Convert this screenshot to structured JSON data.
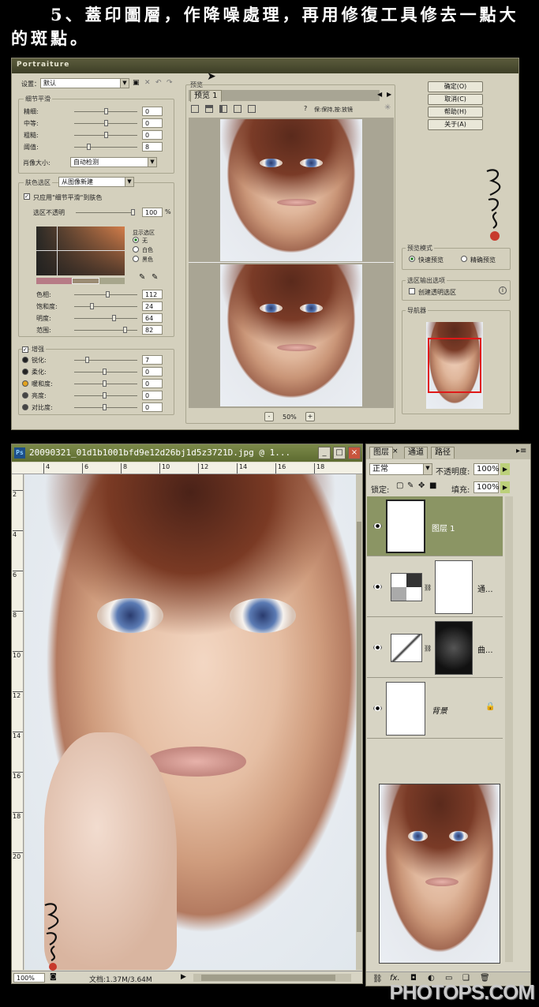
{
  "heading": {
    "line1": "5、蓋印圖層，作降噪處理，再用修復工具修去一點大",
    "line2": "的斑點。"
  },
  "portraiture": {
    "title": "Portraiture",
    "preset_label": "设置：",
    "preset_value": "默认",
    "detail_group": "细节平滑",
    "detail_rows": [
      {
        "label": "精细:",
        "value": "0"
      },
      {
        "label": "中等:",
        "value": "0"
      },
      {
        "label": "粗糙:",
        "value": "0"
      },
      {
        "label": "阈值:",
        "value": "8"
      }
    ],
    "portrait_size_label": "肖像大小:",
    "portrait_size_value": "自动检测",
    "skin_group": "肤色选区",
    "skin_mode": "从图像新建",
    "only_apply": "只应用\"细节平滑\"到肤色",
    "opacity_label": "选区不透明",
    "opacity_value": "100",
    "opacity_unit": "%",
    "show_mask": "显示选区",
    "mask_options": [
      "无",
      "白色",
      "黑色"
    ],
    "color_rows": [
      {
        "label": "色相:",
        "value": "112"
      },
      {
        "label": "饱和度:",
        "value": "24"
      },
      {
        "label": "明度:",
        "value": "64"
      },
      {
        "label": "范围:",
        "value": "82"
      }
    ],
    "enhance_label": "增强",
    "enhance_rows": [
      {
        "label": "锐化:",
        "value": "7"
      },
      {
        "label": "柔化:",
        "value": "0"
      },
      {
        "label": "暖和度:",
        "value": "0"
      },
      {
        "label": "亮度:",
        "value": "0"
      },
      {
        "label": "对比度:",
        "value": "0"
      }
    ],
    "preview_label": "预览",
    "preview_tab": "预览 1",
    "preview_hint": "保:保持,按:放镜",
    "zoom": "50%",
    "zoom_minus": "-",
    "zoom_plus": "+",
    "buttons": [
      "确定(O)",
      "取消(C)",
      "帮助(H)",
      "关于(A)"
    ],
    "preview_mode": "预览模式",
    "mode_options": [
      "快速预览",
      "精确预览"
    ],
    "output_group": "选区输出选项",
    "output_check": "创建透明选区",
    "navigator": "导航器"
  },
  "photoshop": {
    "ps_icon": "Ps",
    "doc_title": "20090321_01d1b1001bfd9e12d26bj1d5z3721D.jpg @ 1...",
    "ruler_marks": [
      "4",
      "6",
      "8",
      "10",
      "12",
      "14",
      "16",
      "18"
    ],
    "vruler_marks": [
      "2",
      "4",
      "6",
      "8",
      "10",
      "12",
      "14",
      "16",
      "18",
      "20"
    ],
    "zoom": "100%",
    "doc_info": "文档:1.37M/3.64M"
  },
  "layers_panel": {
    "tabs": [
      "图层",
      "通道",
      "路径"
    ],
    "tab_close": "×",
    "blend": "正常",
    "opacity_label": "不透明度:",
    "opacity": "100%",
    "lock_label": "锁定:",
    "fill_label": "填充:",
    "fill": "100%",
    "layers": [
      {
        "name": "图层 1"
      },
      {
        "name": "通..."
      },
      {
        "name": "曲..."
      },
      {
        "name": "背景"
      }
    ],
    "footer_fx": "fx."
  },
  "watermark": "PHOTOPS.COM",
  "colors": {
    "accent": "#8b9564",
    "title_bar": "#5d6b30"
  }
}
